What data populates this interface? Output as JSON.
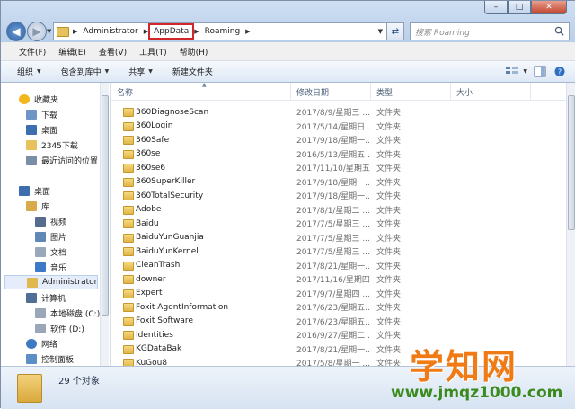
{
  "window": {
    "caption_buttons": {
      "minimize": "–",
      "maximize": "□",
      "close": "✕"
    }
  },
  "address_bar": {
    "crumbs": [
      "Administrator",
      "AppData",
      "Roaming"
    ],
    "highlighted_crumb": "AppData"
  },
  "search": {
    "placeholder": "搜索 Roaming"
  },
  "menu": [
    "文件(F)",
    "编辑(E)",
    "查看(V)",
    "工具(T)",
    "帮助(H)"
  ],
  "toolbar": {
    "organize": "组织",
    "include_in_library": "包含到库中",
    "share": "共享",
    "new_folder": "新建文件夹"
  },
  "nav_pane": {
    "items": [
      {
        "label": "收藏夹",
        "icon": "star-icon",
        "level": 0
      },
      {
        "label": "下载",
        "icon": "download-folder-icon",
        "level": 1
      },
      {
        "label": "桌面",
        "icon": "desktop-icon",
        "level": 1
      },
      {
        "label": "2345下载",
        "icon": "folder-icon",
        "level": 1
      },
      {
        "label": "最近访问的位置",
        "icon": "recent-places-icon",
        "level": 1
      },
      {
        "label": "桌面",
        "icon": "desktop-icon",
        "level": 0
      },
      {
        "label": "库",
        "icon": "library-icon",
        "level": 1
      },
      {
        "label": "视频",
        "icon": "video-library-icon",
        "level": 2
      },
      {
        "label": "图片",
        "icon": "picture-library-icon",
        "level": 2
      },
      {
        "label": "文档",
        "icon": "document-library-icon",
        "level": 2
      },
      {
        "label": "音乐",
        "icon": "music-library-icon",
        "level": 2
      },
      {
        "label": "Administrator",
        "icon": "user-folder-icon",
        "level": 1,
        "selected": true
      },
      {
        "label": "计算机",
        "icon": "computer-icon",
        "level": 1
      },
      {
        "label": "本地磁盘 (C:)",
        "icon": "drive-icon",
        "level": 2
      },
      {
        "label": "软件 (D:)",
        "icon": "drive-icon",
        "level": 2
      },
      {
        "label": "网络",
        "icon": "network-icon",
        "level": 1
      },
      {
        "label": "控制面板",
        "icon": "control-panel-icon",
        "level": 1
      }
    ]
  },
  "file_list": {
    "columns": [
      "名称",
      "修改日期",
      "类型",
      "大小"
    ],
    "rows": [
      {
        "name": "360DiagnoseScan",
        "date": "2017/8/9/星期三 ...",
        "type": "文件夹"
      },
      {
        "name": "360Login",
        "date": "2017/5/14/星期日 ...",
        "type": "文件夹"
      },
      {
        "name": "360Safe",
        "date": "2017/9/18/星期一...",
        "type": "文件夹"
      },
      {
        "name": "360se",
        "date": "2016/5/13/星期五 ...",
        "type": "文件夹"
      },
      {
        "name": "360se6",
        "date": "2017/11/10/星期五...",
        "type": "文件夹"
      },
      {
        "name": "360SuperKiller",
        "date": "2017/9/18/星期一...",
        "type": "文件夹"
      },
      {
        "name": "360TotalSecurity",
        "date": "2017/9/18/星期一...",
        "type": "文件夹"
      },
      {
        "name": "Adobe",
        "date": "2017/8/1/星期二 ...",
        "type": "文件夹"
      },
      {
        "name": "Baidu",
        "date": "2017/7/5/星期三 ...",
        "type": "文件夹"
      },
      {
        "name": "BaiduYunGuanjia",
        "date": "2017/7/5/星期三 ...",
        "type": "文件夹"
      },
      {
        "name": "BaiduYunKernel",
        "date": "2017/7/5/星期三 ...",
        "type": "文件夹"
      },
      {
        "name": "CleanTrash",
        "date": "2017/8/21/星期一...",
        "type": "文件夹"
      },
      {
        "name": "downer",
        "date": "2017/11/16/星期四...",
        "type": "文件夹"
      },
      {
        "name": "Expert",
        "date": "2017/9/7/星期四 ...",
        "type": "文件夹"
      },
      {
        "name": "Foxit AgentInformation",
        "date": "2017/6/23/星期五...",
        "type": "文件夹"
      },
      {
        "name": "Foxit Software",
        "date": "2017/6/23/星期五...",
        "type": "文件夹"
      },
      {
        "name": "Identities",
        "date": "2016/9/27/星期二 ...",
        "type": "文件夹"
      },
      {
        "name": "KGDataBak",
        "date": "2017/8/21/星期一...",
        "type": "文件夹"
      },
      {
        "name": "KuGou8",
        "date": "2017/5/8/星期一 ...",
        "type": "文件夹"
      }
    ]
  },
  "status": {
    "item_count": "29 个对象"
  },
  "watermark": {
    "title": "学知网",
    "url": "www.jmqz1000.com"
  }
}
